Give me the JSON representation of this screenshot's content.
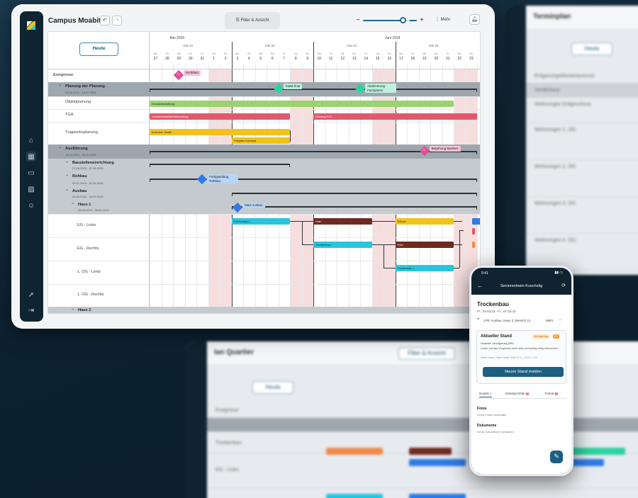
{
  "app": {
    "project_title": "Campus Moabit",
    "filter_label": "Filter & Ansicht",
    "more_label": "Mehr",
    "today_label": "Heute",
    "zoom_minus": "−",
    "zoom_plus": "+",
    "zoom_level": 0.78
  },
  "timeline": {
    "months": [
      "Mai 2024",
      "Juni 2024"
    ],
    "weeks": [
      "KW 22",
      "KW 23",
      "KW 24",
      "KW 25"
    ],
    "day_names": [
      "Mo",
      "Di",
      "Mi",
      "Do",
      "Fr",
      "Sa",
      "So",
      "Mo",
      "Di",
      "Mi",
      "Do",
      "Fr",
      "Sa",
      "So",
      "Mo",
      "Di",
      "Mi",
      "Do",
      "Fr",
      "Sa",
      "So",
      "Mo",
      "Di",
      "Mi",
      "Do",
      "Fr",
      "Sa",
      "So"
    ],
    "day_numbers": [
      "27",
      "28",
      "29",
      "30",
      "31",
      "1",
      "2",
      "3",
      "4",
      "5",
      "6",
      "7",
      "8",
      "9",
      "10",
      "11",
      "12",
      "13",
      "14",
      "15",
      "16",
      "17",
      "18",
      "19",
      "20",
      "21",
      "22",
      "23"
    ]
  },
  "rows": {
    "events": "Ereignisse",
    "planning": {
      "name": "Planung der Planung",
      "dates": "22.03.2023 - 13.07.2024"
    },
    "objektplanung": "Objektplanung",
    "tga": "TGA",
    "tragwerk": "Tragwerksplanung",
    "ausfuehrung": {
      "name": "Ausführung",
      "dates": "15.04.2024 - 28.05.2025"
    },
    "baustelle": {
      "name": "Baustelleneinrichtung",
      "dates": "27.05.2025 - 07.06.2025"
    },
    "rohbau": {
      "name": "Rohbau",
      "dates": "03.01.2025 - 31.05.2026"
    },
    "ausbau": {
      "name": "Ausbau",
      "dates": "03.06.2024 - 28.09.2025"
    },
    "haus1": {
      "name": "Haus 1",
      "dates": "03.06.2024 - 09.09.2024"
    },
    "eg_links": "EG - Links",
    "eg_rechts": "EG - Rechts",
    "og_links": "1. OG - Links",
    "og_rechts": "1. OG - Rechts",
    "haus2": "Haus 2"
  },
  "bars": {
    "konzept": "Konzepterstellung",
    "tga_b1": "Vorschlaftabellenbearbeitung",
    "planung_h2": "Planung HI 2",
    "korrektur": "Korrektur Statik",
    "freigabe": "Freigabe Konzept",
    "trockenbau": "Trockenbau I",
    "putz": "Putz",
    "estrich": "Estrich"
  },
  "milestones": {
    "richtfest": "Richtfest",
    "statik_final": "Statik final",
    "abstimmung": "Abstimmung Fachplaner",
    "begehung": "Begehung Bauherr",
    "fertigstellung": "Fertigstellung Rohbau",
    "start_ausbau": "Start Ausbau"
  },
  "phone": {
    "time": "9:41",
    "nav_title": "Seniorenheim Kuschelig",
    "task_title": "Trockenbau",
    "task_dates": "Fr., 03.03.23 - Fr., 07.03.23",
    "location": "LP8, Ausbau, Haus 3, Bereich 12",
    "more": "Mehr",
    "current_state_title": "Aktueller Stand",
    "status_badge": "Verzögerung",
    "status_count": "2 T",
    "state_reason": "Ursache: Verzögerung NHV",
    "state_text": "Leider hat das Vorgewerk nicht alles rechtzeitig fertig bekommen",
    "state_author": "Walter Kaiser | Kaiser Walter GmbH & Co. | 05.03. 17:00",
    "new_state_button": "Neuen Stand melden",
    "tabs": [
      {
        "label": "Details",
        "count": "2"
      },
      {
        "label": "Arbeitsschritte",
        "count": "3"
      },
      {
        "label": "Tickets",
        "count": "1"
      }
    ],
    "photos_title": "Fotos",
    "photos_empty": "Keine Fotos vorhanden",
    "docs_title": "Dokumente",
    "docs_empty": "Keine Dokumente vorhanden"
  },
  "background_windows": {
    "right_title": "Terminplan",
    "right_today": "Heute",
    "right_rows": [
      "Entgasungsklesseraussuss",
      "Vorderhaus",
      "Wohnungen Erdgeschoss",
      "Wohnungen 1. OG",
      "Wohnungen 2. OG",
      "Wohnungen 3. OG",
      "Wohnungen 4. OG"
    ],
    "bottom_title": "Ian Quartier",
    "bottom_today": "Heute",
    "bottom_button": "Filter & Ansicht",
    "bottom_rows": [
      "Ereignisse",
      "Trockenbau",
      "EG - Links"
    ]
  },
  "colors": {
    "green": "#9ad36f",
    "red": "#e3586b",
    "yellow": "#f2c21b",
    "teal": "#27c6de",
    "brown": "#6f2a1f",
    "diamond_green": "#2bd39f",
    "diamond_pink": "#e44a9a",
    "diamond_blue": "#2d7be8"
  }
}
